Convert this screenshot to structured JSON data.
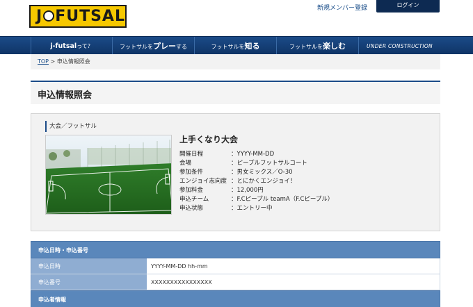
{
  "header": {
    "logo_left": "J",
    "logo_right": "FUTSAL",
    "signup_link": "新規メンバー登録",
    "login_button": "ログイン"
  },
  "nav": {
    "items": [
      {
        "pre": "j-futsal",
        "bold": "",
        "post": "って？"
      },
      {
        "pre": "フットサルを",
        "bold": "プレー",
        "post": "する"
      },
      {
        "pre": "フットサルを",
        "bold": "知る",
        "post": ""
      },
      {
        "pre": "フットサルを",
        "bold": "楽しむ",
        "post": ""
      },
      {
        "pre": "UNDER CONSTRUCTION",
        "bold": "",
        "post": ""
      }
    ]
  },
  "breadcrumb": {
    "home": "TOP",
    "separator": " > ",
    "current": "申込情報照会"
  },
  "page": {
    "title": "申込情報照会"
  },
  "event": {
    "category": "大会／フットサル",
    "name": "上手くなり大会",
    "details": [
      {
        "label": "開催日程",
        "value": "：YYYY-MM-DD"
      },
      {
        "label": "会場",
        "value": "：ピープルフットサルコート"
      },
      {
        "label": "参加条件",
        "value": "：男女ミックス／O-30"
      },
      {
        "label": "エンジョイ志向度",
        "value": "：とにかくエンジョイ！"
      },
      {
        "label": "参加料金",
        "value": "：12,000円"
      },
      {
        "label": "申込チーム",
        "value": "：F.Cピープル teamA（F.Cピープル）"
      },
      {
        "label": "申込状態",
        "value": "：エントリー中"
      }
    ]
  },
  "application": {
    "section_title": "申込日時・申込番号",
    "rows": [
      {
        "label": "申込日時",
        "value": "YYYY-MM-DD hh-mm"
      },
      {
        "label": "申込番号",
        "value": "XXXXXXXXXXXXXXXX"
      }
    ],
    "applicant_section_title": "申込者情報"
  },
  "colors": {
    "nav_blue": "#1b4b88",
    "logo_yellow": "#f6c800",
    "table_header": "#5a87bb",
    "table_label": "#8fadd2"
  }
}
